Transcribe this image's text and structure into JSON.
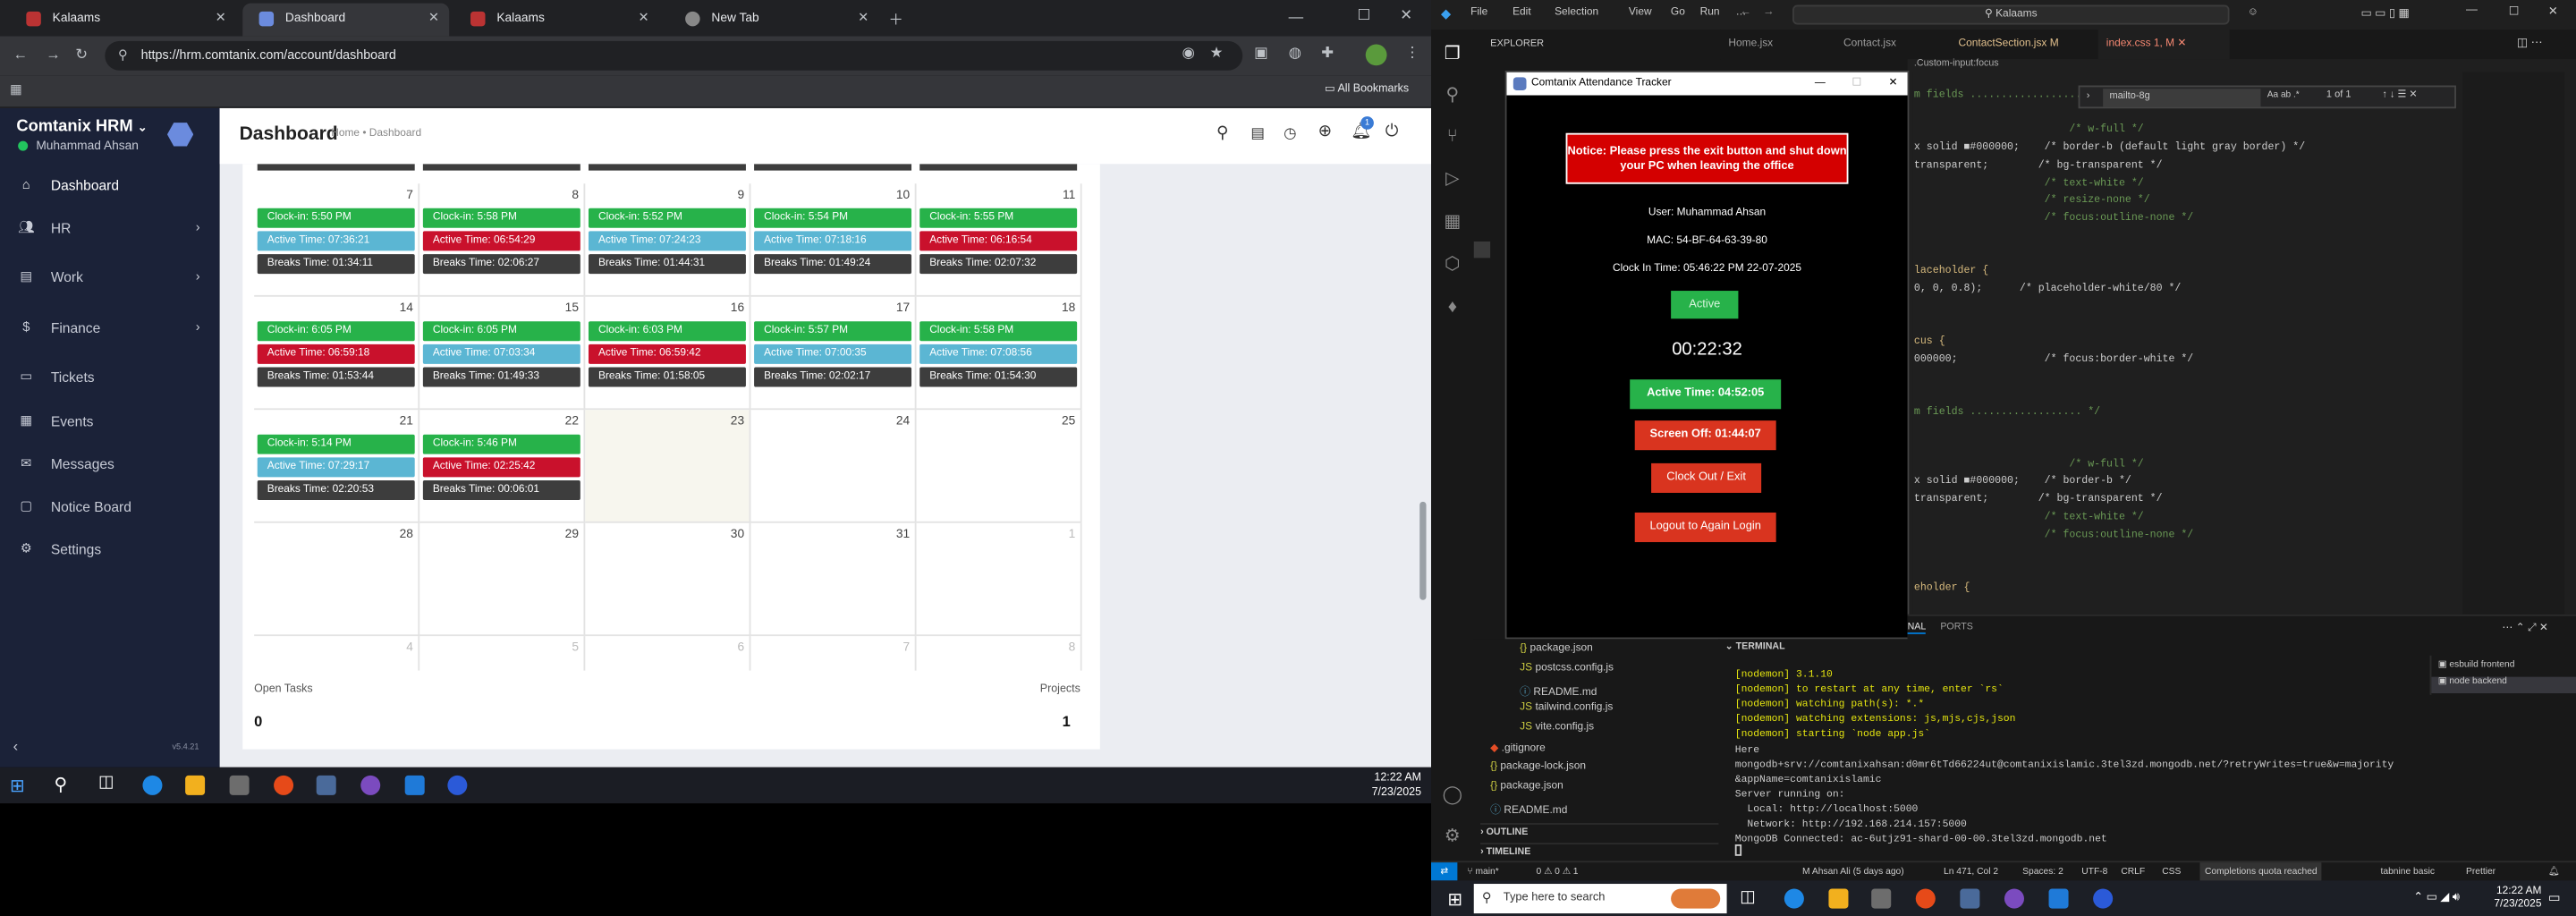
{
  "browser": {
    "tabs": [
      {
        "label": "Kalaams",
        "active": false
      },
      {
        "label": "Dashboard",
        "active": true
      },
      {
        "label": "Kalaams",
        "active": false
      },
      {
        "label": "New Tab",
        "active": false
      }
    ],
    "url": "https://hrm.comtanix.com/account/dashboard",
    "bookmarks_label": "All Bookmarks"
  },
  "hrm": {
    "brand": "Comtanix HRM",
    "user": "Muhammad Ahsan",
    "menu": [
      {
        "label": "Dashboard",
        "icon": "home-icon",
        "chev": false
      },
      {
        "label": "HR",
        "icon": "users-icon",
        "chev": true
      },
      {
        "label": "Work",
        "icon": "briefcase-icon",
        "chev": true
      },
      {
        "label": "Finance",
        "icon": "dollar-icon",
        "chev": true
      },
      {
        "label": "Tickets",
        "icon": "ticket-icon",
        "chev": false
      },
      {
        "label": "Events",
        "icon": "calendar-icon",
        "chev": false
      },
      {
        "label": "Messages",
        "icon": "chat-icon",
        "chev": false
      },
      {
        "label": "Notice Board",
        "icon": "board-icon",
        "chev": false
      },
      {
        "label": "Settings",
        "icon": "gear-icon",
        "chev": false
      }
    ],
    "version": "v5.4.21",
    "page_title": "Dashboard",
    "breadcrumb": "Home • Dashboard",
    "notif_count": "1",
    "calendar_weeks": [
      [
        {
          "day": "7",
          "events": [
            {
              "t": "Clock-in: 5:50 PM",
              "c": "green"
            },
            {
              "t": "Active Time: 07:36:21",
              "c": "teal"
            },
            {
              "t": "Breaks Time: 01:34:11",
              "c": "dark"
            }
          ]
        },
        {
          "day": "8",
          "events": [
            {
              "t": "Clock-in: 5:58 PM",
              "c": "green"
            },
            {
              "t": "Active Time: 06:54:29",
              "c": "red"
            },
            {
              "t": "Breaks Time: 02:06:27",
              "c": "dark"
            }
          ]
        },
        {
          "day": "9",
          "events": [
            {
              "t": "Clock-in: 5:52 PM",
              "c": "green"
            },
            {
              "t": "Active Time: 07:24:23",
              "c": "teal"
            },
            {
              "t": "Breaks Time: 01:44:31",
              "c": "dark"
            }
          ]
        },
        {
          "day": "10",
          "events": [
            {
              "t": "Clock-in: 5:54 PM",
              "c": "green"
            },
            {
              "t": "Active Time: 07:18:16",
              "c": "teal"
            },
            {
              "t": "Breaks Time: 01:49:24",
              "c": "dark"
            }
          ]
        },
        {
          "day": "11",
          "events": [
            {
              "t": "Clock-in: 5:55 PM",
              "c": "green"
            },
            {
              "t": "Active Time: 06:16:54",
              "c": "red"
            },
            {
              "t": "Breaks Time: 02:07:32",
              "c": "dark"
            }
          ]
        }
      ],
      [
        {
          "day": "14",
          "events": [
            {
              "t": "Clock-in: 6:05 PM",
              "c": "green"
            },
            {
              "t": "Active Time: 06:59:18",
              "c": "red"
            },
            {
              "t": "Breaks Time: 01:53:44",
              "c": "dark"
            }
          ]
        },
        {
          "day": "15",
          "events": [
            {
              "t": "Clock-in: 6:05 PM",
              "c": "green"
            },
            {
              "t": "Active Time: 07:03:34",
              "c": "teal"
            },
            {
              "t": "Breaks Time: 01:49:33",
              "c": "dark"
            }
          ]
        },
        {
          "day": "16",
          "events": [
            {
              "t": "Clock-in: 6:03 PM",
              "c": "green"
            },
            {
              "t": "Active Time: 06:59:42",
              "c": "red"
            },
            {
              "t": "Breaks Time: 01:58:05",
              "c": "dark"
            }
          ]
        },
        {
          "day": "17",
          "events": [
            {
              "t": "Clock-in: 5:57 PM",
              "c": "green"
            },
            {
              "t": "Active Time: 07:00:35",
              "c": "teal"
            },
            {
              "t": "Breaks Time: 02:02:17",
              "c": "dark"
            }
          ]
        },
        {
          "day": "18",
          "events": [
            {
              "t": "Clock-in: 5:58 PM",
              "c": "green"
            },
            {
              "t": "Active Time: 07:08:56",
              "c": "teal"
            },
            {
              "t": "Breaks Time: 01:54:30",
              "c": "dark"
            }
          ]
        }
      ],
      [
        {
          "day": "21",
          "events": [
            {
              "t": "Clock-in: 5:14 PM",
              "c": "green"
            },
            {
              "t": "Active Time: 07:29:17",
              "c": "teal"
            },
            {
              "t": "Breaks Time: 02:20:53",
              "c": "dark"
            }
          ]
        },
        {
          "day": "22",
          "events": [
            {
              "t": "Clock-in: 5:46 PM",
              "c": "green"
            },
            {
              "t": "Active Time: 02:25:42",
              "c": "red"
            },
            {
              "t": "Breaks Time: 00:06:01",
              "c": "dark"
            }
          ]
        },
        {
          "day": "23",
          "events": [],
          "today": true
        },
        {
          "day": "24",
          "events": []
        },
        {
          "day": "25",
          "events": []
        }
      ],
      [
        {
          "day": "28",
          "events": []
        },
        {
          "day": "29",
          "events": []
        },
        {
          "day": "30",
          "events": []
        },
        {
          "day": "31",
          "events": []
        },
        {
          "day": "1",
          "events": [],
          "muted": true
        }
      ],
      [
        {
          "day": "4",
          "events": [],
          "muted": true
        },
        {
          "day": "5",
          "events": [],
          "muted": true
        },
        {
          "day": "6",
          "events": [],
          "muted": true
        },
        {
          "day": "7",
          "events": [],
          "muted": true
        },
        {
          "day": "8",
          "events": [],
          "muted": true
        }
      ]
    ],
    "stats": {
      "open_tasks_label": "Open Tasks",
      "open_tasks": "0",
      "projects_label": "Projects",
      "projects": "1"
    }
  },
  "windows": {
    "left_clock": {
      "time": "12:22 AM",
      "date": "7/23/2025"
    },
    "right_clock": {
      "time": "12:22 AM",
      "date": "7/23/2025"
    },
    "search_placeholder": "Type here to search"
  },
  "vscode": {
    "menu": [
      "File",
      "Edit",
      "Selection",
      "View",
      "Go",
      "Run",
      "…"
    ],
    "search": "Kalaams",
    "explorer_label": "EXPLORER",
    "tabs": [
      "Home.jsx",
      "Contact.jsx",
      "ContactSection.jsx M",
      "index.css 1, M"
    ],
    "breadcrumb_tail": ".Custom-input:focus",
    "find_value": "mailto-8g",
    "find_result": "1 of 1",
    "code": [
      {
        "t": "m fields .................. */",
        "k": "cm"
      },
      {
        "t": "",
        "k": ""
      },
      {
        "t": "                         /* w-full */",
        "k": "cm"
      },
      {
        "t": "x solid ■#000000;    /* border-b (default light gray border) */",
        "k": ""
      },
      {
        "t": "transparent;        /* bg-transparent */",
        "k": ""
      },
      {
        "t": "                     /* text-white */",
        "k": "cm"
      },
      {
        "t": "                     /* resize-none */",
        "k": "cm"
      },
      {
        "t": "                     /* focus:outline-none */",
        "k": "cm"
      },
      {
        "t": "",
        "k": ""
      },
      {
        "t": "",
        "k": ""
      },
      {
        "t": "laceholder {",
        "k": "kw"
      },
      {
        "t": "0, 0, 0.8);      /* placeholder-white/80 */",
        "k": ""
      },
      {
        "t": "",
        "k": ""
      },
      {
        "t": "",
        "k": ""
      },
      {
        "t": "cus {",
        "k": "kw"
      },
      {
        "t": "000000;              /* focus:border-white */",
        "k": ""
      },
      {
        "t": "",
        "k": ""
      },
      {
        "t": "",
        "k": ""
      },
      {
        "t": "m fields .................. */",
        "k": "cm"
      },
      {
        "t": "",
        "k": ""
      },
      {
        "t": "",
        "k": ""
      },
      {
        "t": "                         /* w-full */",
        "k": "cm"
      },
      {
        "t": "x solid ■#000000;    /* border-b */",
        "k": ""
      },
      {
        "t": "transparent;        /* bg-transparent */",
        "k": ""
      },
      {
        "t": "                     /* text-white */",
        "k": "cm"
      },
      {
        "t": "                     /* focus:outline-none */",
        "k": "cm"
      },
      {
        "t": "",
        "k": ""
      },
      {
        "t": "",
        "k": ""
      },
      {
        "t": "eholder {",
        "k": "kw"
      }
    ],
    "files": [
      {
        "name": "package.json",
        "icon": "json-icon"
      },
      {
        "name": "postcss.config.js",
        "icon": "js-icon"
      },
      {
        "name": "README.md",
        "icon": "info-icon"
      },
      {
        "name": "tailwind.config.js",
        "icon": "js-icon"
      },
      {
        "name": "vite.config.js",
        "icon": "js-icon"
      },
      {
        "name": ".gitignore",
        "icon": "git-icon"
      },
      {
        "name": "package-lock.json",
        "icon": "json-icon"
      },
      {
        "name": "package.json",
        "icon": "json-icon"
      },
      {
        "name": "README.md",
        "icon": "info-icon"
      }
    ],
    "outline_label": "OUTLINE",
    "timeline_label": "TIMELINE",
    "panel_tabs": [
      "TERMINAL",
      "PORTS"
    ],
    "terminal_label": "TERMINAL",
    "terminal_lines": [
      {
        "t": "[nodemon] 3.1.10",
        "y": true
      },
      {
        "t": "[nodemon] to restart at any time, enter `rs`",
        "y": true
      },
      {
        "t": "[nodemon] watching path(s): *.*",
        "y": true
      },
      {
        "t": "[nodemon] watching extensions: js,mjs,cjs,json",
        "y": true
      },
      {
        "t": "[nodemon] starting `node app.js`",
        "y": true
      },
      {
        "t": "Here",
        "y": false
      },
      {
        "t": "mongodb+srv://comtanixahsan:d0mr6tTd66224ut@comtanixislamic.3tel3zd.mongodb.net/?retryWrites=true&w=majority",
        "y": false
      },
      {
        "t": "&appName=comtanixislamic",
        "y": false
      },
      {
        "t": "Server running on:",
        "y": false
      },
      {
        "t": "  Local: http://localhost:5000",
        "y": false
      },
      {
        "t": "  Network: http://192.168.214.157:5000",
        "y": false
      },
      {
        "t": "MongoDB Connected: ac-6utjz91-shard-00-00.3tel3zd.mongodb.net",
        "y": false
      }
    ],
    "terminals": [
      "esbuild frontend",
      "node backend"
    ],
    "status": {
      "branch": "main*",
      "problems": "0 ⚠ 0 ⚠ 1",
      "blame": "M Ahsan Ali (5 days ago)",
      "pos": "Ln 471, Col 2",
      "spaces": "Spaces: 2",
      "enc": "UTF-8",
      "eol": "CRLF",
      "lang": "CSS",
      "quota": "Completions quota reached",
      "tabnine": "tabnine basic",
      "prettier": "Prettier"
    }
  },
  "tracker": {
    "title": "Comtanix Attendance Tracker",
    "notice": "Notice: Please press the exit button and shut down your PC when leaving the office",
    "user": "User: Muhammad Ahsan",
    "mac": "MAC: 54-BF-64-63-39-80",
    "clock_in": "Clock In Time: 05:46:22 PM 22-07-2025",
    "status": "Active",
    "timer": "00:22:32",
    "active_time": "Active Time: 04:52:05",
    "screen_off": "Screen Off: 01:44:07",
    "clock_out": "Clock Out / Exit",
    "logout": "Logout to Again Login"
  },
  "colors": {
    "accent": "#6b8bde",
    "green": "#27b24a",
    "red": "#c9112c",
    "teal": "#5bb6d3",
    "sidebar": "#1b2238",
    "vscode_bg": "#1f1f1f"
  }
}
